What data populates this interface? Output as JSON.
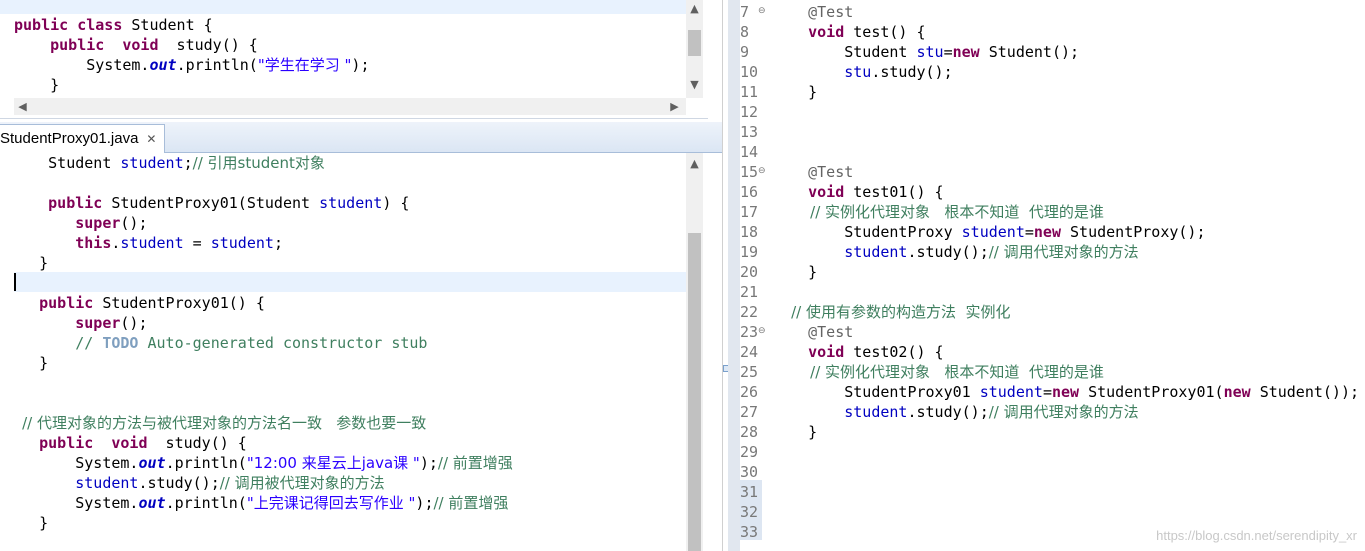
{
  "top_editor": {
    "lines": [
      [
        {
          "t": "public class ",
          "c": "kw"
        },
        {
          "t": "Student {",
          "c": ""
        }
      ],
      [
        {
          "t": "    public  void ",
          "c": "kw"
        },
        {
          "t": " study() {",
          "c": ""
        }
      ],
      [
        {
          "t": "        System.",
          "c": ""
        },
        {
          "t": "out",
          "c": "sfld"
        },
        {
          "t": ".println(",
          "c": ""
        },
        {
          "t": "\"学生在学习 \"",
          "c": "str cjk"
        },
        {
          "t": ");",
          "c": ""
        }
      ],
      [
        {
          "t": "    }",
          "c": ""
        }
      ]
    ]
  },
  "tab": {
    "label": "StudentProxy01.java",
    "close": "✕"
  },
  "bottom_editor": {
    "lines": [
      [
        {
          "t": "     Student ",
          "c": ""
        },
        {
          "t": "student",
          "c": "fld"
        },
        {
          "t": ";",
          "c": ""
        },
        {
          "t": "// 引用student对象",
          "c": "cmt cjk"
        }
      ],
      [],
      [
        {
          "t": "     public ",
          "c": "kw"
        },
        {
          "t": "StudentProxy01(Student ",
          "c": ""
        },
        {
          "t": "student",
          "c": "fld"
        },
        {
          "t": ") {",
          "c": ""
        }
      ],
      [
        {
          "t": "        super",
          "c": "kw"
        },
        {
          "t": "();",
          "c": ""
        }
      ],
      [
        {
          "t": "        this",
          "c": "kw"
        },
        {
          "t": ".",
          "c": ""
        },
        {
          "t": "student",
          "c": "fld"
        },
        {
          "t": " = ",
          "c": ""
        },
        {
          "t": "student",
          "c": "fld"
        },
        {
          "t": ";",
          "c": ""
        }
      ],
      [
        {
          "t": "    }",
          "c": ""
        }
      ],
      [],
      [
        {
          "t": "    public ",
          "c": "kw"
        },
        {
          "t": "StudentProxy01() {",
          "c": ""
        }
      ],
      [
        {
          "t": "        super",
          "c": "kw"
        },
        {
          "t": "();",
          "c": ""
        }
      ],
      [
        {
          "t": "        // ",
          "c": "cmt"
        },
        {
          "t": "TODO",
          "c": "todo"
        },
        {
          "t": " Auto-generated constructor stub",
          "c": "cmt"
        }
      ],
      [
        {
          "t": "    }",
          "c": ""
        }
      ],
      [],
      [],
      [
        {
          "t": "    // 代理对象的方法与被代理对象的方法名一致   参数也要一致",
          "c": "cmt cjk"
        }
      ],
      [
        {
          "t": "    public  void ",
          "c": "kw"
        },
        {
          "t": " study() {",
          "c": ""
        }
      ],
      [
        {
          "t": "        System.",
          "c": ""
        },
        {
          "t": "out",
          "c": "sfld"
        },
        {
          "t": ".println(",
          "c": ""
        },
        {
          "t": "\"12:00 来星云上java课 \"",
          "c": "str cjk"
        },
        {
          "t": ");",
          "c": ""
        },
        {
          "t": "// 前置增强",
          "c": "cmt cjk"
        }
      ],
      [
        {
          "t": "        student",
          "c": "fld"
        },
        {
          "t": ".study();",
          "c": ""
        },
        {
          "t": "// 调用被代理对象的方法",
          "c": "cmt cjk"
        }
      ],
      [
        {
          "t": "        System.",
          "c": ""
        },
        {
          "t": "out",
          "c": "sfld"
        },
        {
          "t": ".println(",
          "c": ""
        },
        {
          "t": "\"上完课记得回去写作业 \"",
          "c": "str cjk"
        },
        {
          "t": ");",
          "c": ""
        },
        {
          "t": "// 前置增强",
          "c": "cmt cjk"
        }
      ],
      [
        {
          "t": "    }",
          "c": ""
        }
      ]
    ]
  },
  "right_editor": {
    "line_numbers": [
      "7",
      "8",
      "9",
      "10",
      "11",
      "12",
      "13",
      "14",
      "15",
      "16",
      "17",
      "18",
      "19",
      "20",
      "21",
      "22",
      "23",
      "24",
      "25",
      "26",
      "27",
      "28",
      "29",
      "30",
      "31",
      "32",
      "33"
    ],
    "lines": [
      [
        {
          "t": "    @Test",
          "c": "ann"
        }
      ],
      [
        {
          "t": "    void ",
          "c": "kw"
        },
        {
          "t": "test() {",
          "c": ""
        }
      ],
      [
        {
          "t": "        Student ",
          "c": ""
        },
        {
          "t": "stu",
          "c": "fld"
        },
        {
          "t": "=",
          "c": ""
        },
        {
          "t": "new ",
          "c": "kw"
        },
        {
          "t": "Student();",
          "c": ""
        }
      ],
      [
        {
          "t": "        stu",
          "c": "fld"
        },
        {
          "t": ".study();",
          "c": ""
        }
      ],
      [
        {
          "t": "    }",
          "c": ""
        }
      ],
      [],
      [],
      [],
      [
        {
          "t": "    @Test",
          "c": "ann"
        }
      ],
      [
        {
          "t": "    void ",
          "c": "kw"
        },
        {
          "t": "test01() {",
          "c": ""
        }
      ],
      [
        {
          "t": "        // 实例化代理对象   根本不知道  代理的是谁",
          "c": "cmt cjk"
        }
      ],
      [
        {
          "t": "        StudentProxy ",
          "c": ""
        },
        {
          "t": "student",
          "c": "fld"
        },
        {
          "t": "=",
          "c": ""
        },
        {
          "t": "new ",
          "c": "kw"
        },
        {
          "t": "StudentProxy();",
          "c": ""
        }
      ],
      [
        {
          "t": "        student",
          "c": "fld"
        },
        {
          "t": ".study();",
          "c": ""
        },
        {
          "t": "// 调用代理对象的方法",
          "c": "cmt cjk"
        }
      ],
      [
        {
          "t": "    }",
          "c": ""
        }
      ],
      [],
      [
        {
          "t": "    // 使用有参数的构造方法  实例化",
          "c": "cmt cjk"
        }
      ],
      [
        {
          "t": "    @Test",
          "c": "ann"
        }
      ],
      [
        {
          "t": "    void ",
          "c": "kw"
        },
        {
          "t": "test02() {",
          "c": ""
        }
      ],
      [
        {
          "t": "        // 实例化代理对象   根本不知道  代理的是谁",
          "c": "cmt cjk"
        }
      ],
      [
        {
          "t": "        StudentProxy01 ",
          "c": ""
        },
        {
          "t": "student",
          "c": "fld"
        },
        {
          "t": "=",
          "c": ""
        },
        {
          "t": "new ",
          "c": "kw"
        },
        {
          "t": "StudentProxy01(",
          "c": ""
        },
        {
          "t": "new ",
          "c": "kw"
        },
        {
          "t": "Student());",
          "c": ""
        }
      ],
      [
        {
          "t": "        student",
          "c": "fld"
        },
        {
          "t": ".study();",
          "c": ""
        },
        {
          "t": "// 调用代理对象的方法",
          "c": "cmt cjk"
        }
      ],
      [
        {
          "t": "    }",
          "c": ""
        }
      ],
      [],
      [],
      [],
      [],
      []
    ]
  },
  "watermark": "https://blog.csdn.net/serendipity_xr"
}
